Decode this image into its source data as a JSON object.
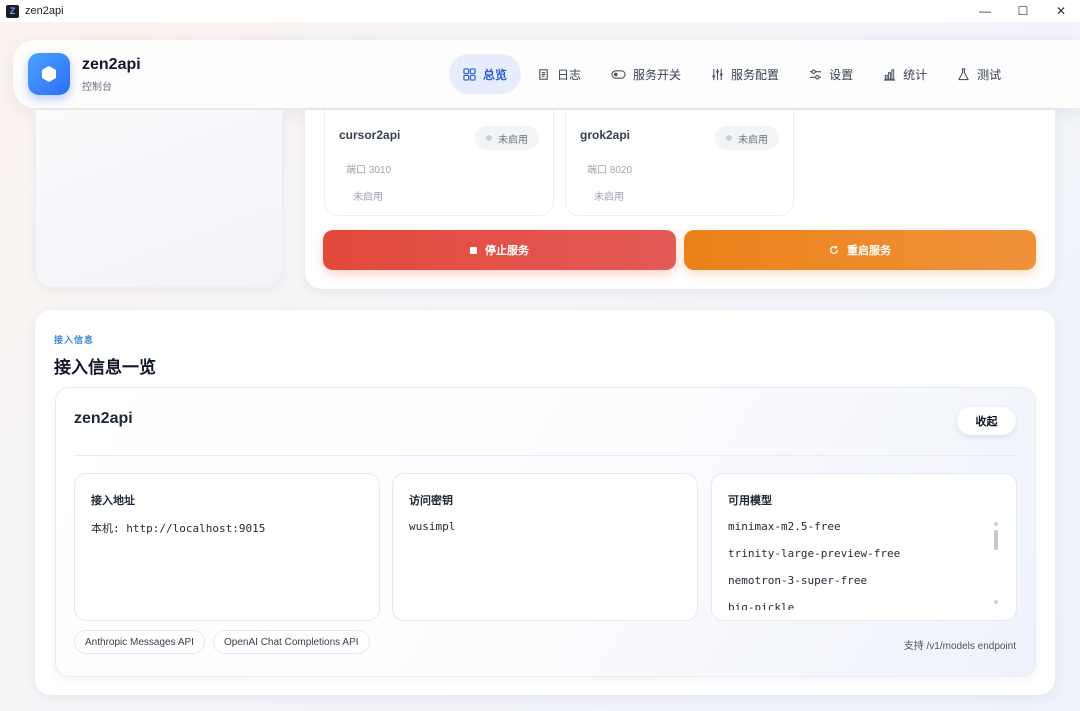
{
  "window": {
    "title": "zen2api",
    "icon_letter": "Z",
    "minimize_glyph": "—",
    "maximize_glyph": "☐",
    "close_glyph": "✕"
  },
  "brand": {
    "name": "zen2api",
    "subtitle": "控制台"
  },
  "nav": {
    "items": [
      {
        "label": "总览",
        "icon": "grid-icon",
        "active": true
      },
      {
        "label": "日志",
        "icon": "scroll-icon",
        "active": false
      },
      {
        "label": "服务开关",
        "icon": "toggle-icon",
        "active": false
      },
      {
        "label": "服务配置",
        "icon": "sliders-icon",
        "active": false
      },
      {
        "label": "设置",
        "icon": "settings-icon",
        "active": false
      },
      {
        "label": "统计",
        "icon": "bar-chart-icon",
        "active": false
      },
      {
        "label": "测试",
        "icon": "flask-icon",
        "active": false
      }
    ]
  },
  "services": [
    {
      "name": "cursor2api",
      "badge": "未启用",
      "port": "端口 3010",
      "status": "未启用"
    },
    {
      "name": "grok2api",
      "badge": "未启用",
      "port": "端口 8020",
      "status": "未启用"
    }
  ],
  "actions": {
    "stop_label": "停止服务",
    "restart_label": "重启服务"
  },
  "access": {
    "eyebrow": "接入信息",
    "title": "接入信息一览",
    "provider": {
      "name": "zen2api",
      "collapse_label": "收起",
      "endpoint_title": "接入地址",
      "endpoint_value": "本机: http://localhost:9015",
      "key_title": "访问密钥",
      "key_value": "wusimpl",
      "models_title": "可用模型",
      "models": [
        "minimax-m2.5-free",
        "trinity-large-preview-free",
        "nemotron-3-super-free",
        "big-pickle"
      ],
      "chips": [
        "Anthropic Messages API",
        "OpenAI Chat Completions API"
      ],
      "support_note": "支持 /v1/models endpoint"
    }
  },
  "colors": {
    "accent": "#2f5fd0",
    "stop": "#e2493b",
    "restart": "#ea8219",
    "eyebrow": "#3c8bd6"
  }
}
